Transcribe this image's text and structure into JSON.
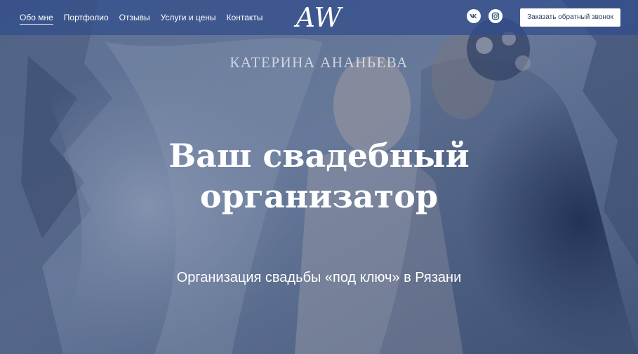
{
  "nav": {
    "items": [
      {
        "label": "Обо мне",
        "active": true
      },
      {
        "label": "Портфолио",
        "active": false
      },
      {
        "label": "Отзывы",
        "active": false
      },
      {
        "label": "Услуги и цены",
        "active": false
      },
      {
        "label": "Контакты",
        "active": false
      }
    ],
    "logo_text": "AW",
    "social": [
      "vk-icon",
      "instagram-icon"
    ],
    "callback_label": "Заказать обратный звонок"
  },
  "hero": {
    "name": "КАТЕРИНА АНАНЬЕВА",
    "headline_line1": "Ваш свадебный",
    "headline_line2": "организатор",
    "subtitle": "Организация свадьбы «под ключ» в Рязани"
  },
  "colors": {
    "navbar": "#304e8c",
    "overlay": "#284070",
    "button_text": "#2d3f5f"
  }
}
